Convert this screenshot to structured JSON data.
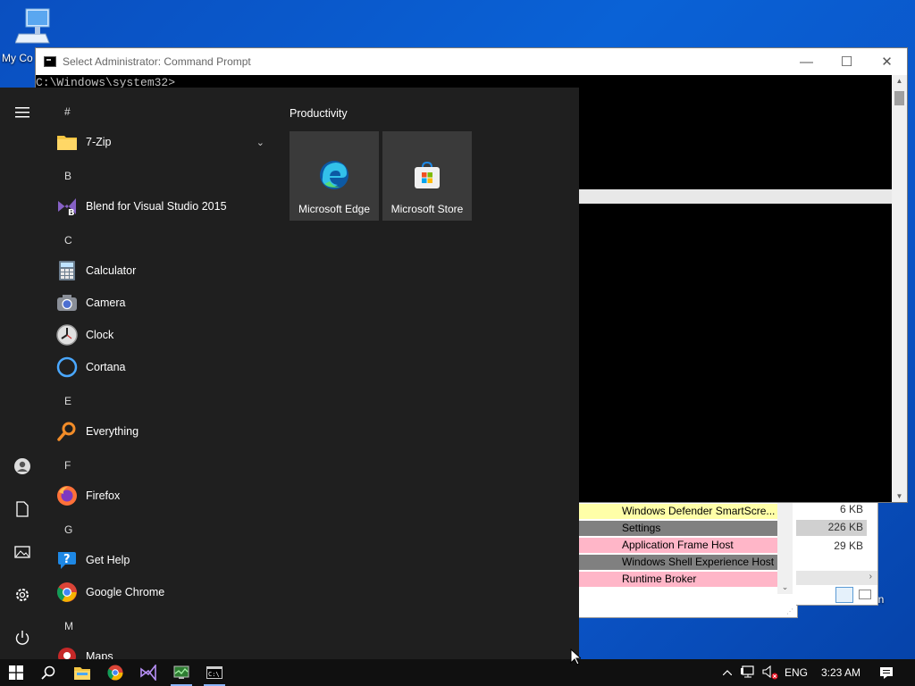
{
  "desktop": {
    "computer_label": "My Co",
    "recycle_label": "e Bin"
  },
  "cmd": {
    "title": "Select Administrator:  Command Prompt",
    "prompt": "C:\\Windows\\system32>",
    "minimize": "—",
    "maximize": "☐",
    "close": "✕"
  },
  "taskmgr": {
    "rows": [
      {
        "name": "Windows Defender SmartScre...",
        "color": "#ffffa8"
      },
      {
        "name": "Settings",
        "color": "#808080"
      },
      {
        "name": "Application Frame Host",
        "color": "#ffb6c8"
      },
      {
        "name": "Windows Shell Experience Host",
        "color": "#808080"
      },
      {
        "name": "Runtime Broker",
        "color": "#ffb6c8"
      }
    ],
    "sizes": [
      "6 KB",
      "226 KB",
      "29 KB"
    ]
  },
  "start": {
    "letters": [
      "#",
      "B",
      "C",
      "E",
      "F",
      "G",
      "M"
    ],
    "apps": {
      "zip": "7-Zip",
      "blend": "Blend for Visual Studio 2015",
      "calculator": "Calculator",
      "camera": "Camera",
      "clock": "Clock",
      "cortana": "Cortana",
      "everything": "Everything",
      "firefox": "Firefox",
      "gethelp": "Get Help",
      "chrome": "Google Chrome",
      "maps": "Maps"
    },
    "group_title": "Productivity",
    "tiles": [
      "Microsoft Edge",
      "Microsoft Store"
    ],
    "rail_icons": [
      "hamburger-icon",
      "user-icon",
      "documents-icon",
      "pictures-icon",
      "settings-icon",
      "power-icon"
    ]
  },
  "taskbar": {
    "language": "ENG",
    "time": "3:23 AM"
  }
}
